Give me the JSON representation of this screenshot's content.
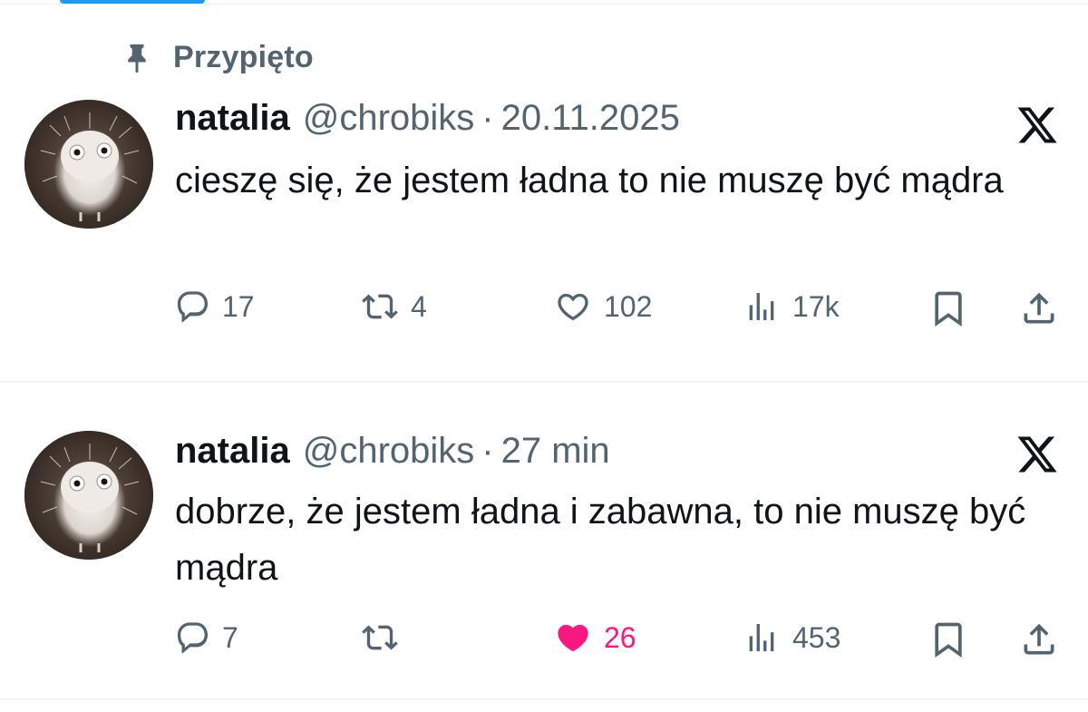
{
  "pinned_label": "Przypięto",
  "tweets": [
    {
      "name": "natalia",
      "handle": "@chrobiks",
      "separator": "·",
      "time": "20.11.2025",
      "text": "cieszę się, że jestem ładna to nie muszę być mądra",
      "replies": "17",
      "reposts": "4",
      "likes": "102",
      "views": "17k",
      "liked": false
    },
    {
      "name": "natalia",
      "handle": "@chrobiks",
      "separator": "·",
      "time": "27 min",
      "text": "dobrze, że jestem ładna i zabawna, to nie muszę być mądra",
      "replies": "7",
      "reposts": "",
      "likes": "26",
      "views": "453",
      "liked": true
    }
  ],
  "colors": {
    "accent": "#1d9bf0",
    "muted": "#536471",
    "text": "#0f1419",
    "like_active": "#f91880",
    "divider": "#eff3f4"
  },
  "icons": {
    "pinned": "pin-icon",
    "platform": "x-logo-icon",
    "reply": "reply-icon",
    "repost": "repost-icon",
    "like": "heart-icon",
    "views": "views-icon",
    "bookmark": "bookmark-icon",
    "share": "share-icon"
  }
}
